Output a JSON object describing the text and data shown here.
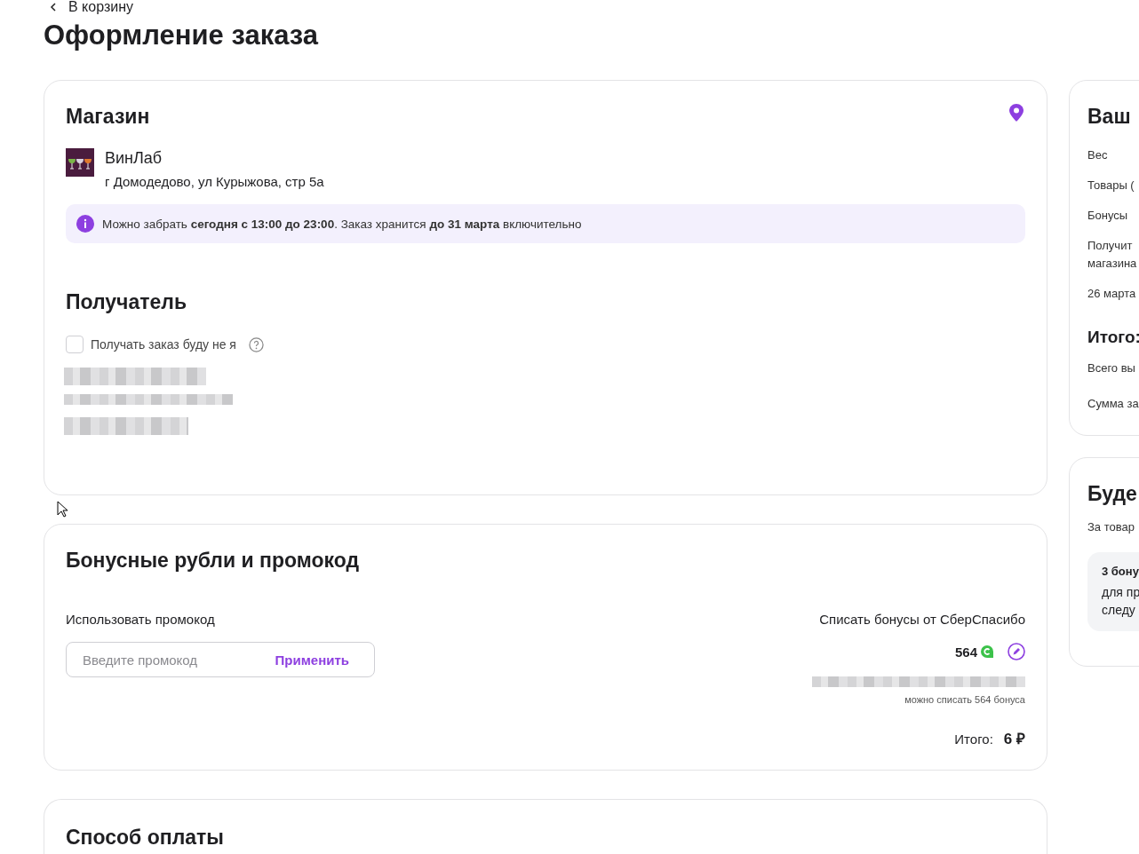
{
  "back_link": "В корзину",
  "title": "Оформление заказа",
  "store": {
    "heading": "Магазин",
    "name": "ВинЛаб",
    "address": "г Домодедово, ул Курыжова, стр 5а",
    "notice": "Можно забрать **сегодня с 13:00 до 23:00**. Заказ хранится **до 31 марта** включительно"
  },
  "recipient": {
    "heading": "Получатель",
    "checkbox": {
      "label": "Получать заказ буду не я",
      "checked": false
    }
  },
  "bonus": {
    "heading": "Бонусные рубли и промокод",
    "promo_label": "Использовать промокод",
    "promo_placeholder": "Введите промокод",
    "apply": "Применить",
    "sber_label": "Списать бонусы от СберСпасибо",
    "balance": "564",
    "hint": "можно списать 564 бонуса",
    "total_label": "Итого:",
    "total_value": "6 ₽"
  },
  "payment": {
    "heading": "Способ оплаты"
  },
  "summary": {
    "heading": "Ваш",
    "rows": [
      "Вес",
      "Товары (",
      "Бонусы",
      "Получит\nмагазина",
      "26 марта"
    ],
    "total_heading": "Итого:",
    "total_rows": [
      "Всего вы",
      "Сумма за"
    ]
  },
  "earn": {
    "heading": "Буде",
    "text": "За товар",
    "box_title": "3 бону",
    "box_text": "для пр\nследу"
  }
}
